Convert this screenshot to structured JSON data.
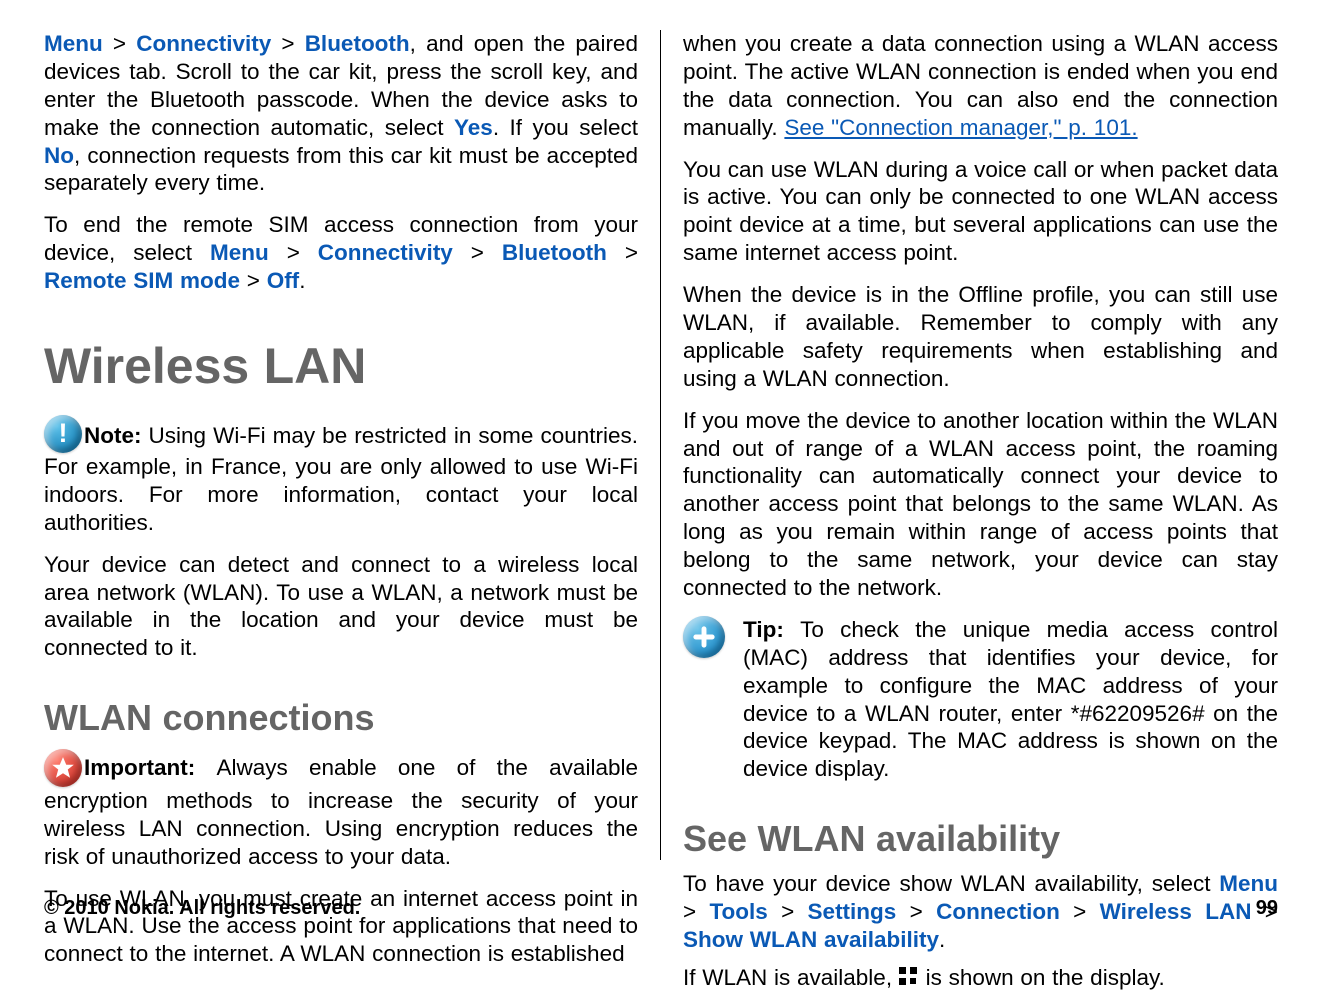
{
  "left": {
    "p1_prefix_menu": "Menu",
    "p1_gt1": " > ",
    "p1_connectivity": "Connectivity",
    "p1_gt2": " > ",
    "p1_bluetooth": "Bluetooth",
    "p1_after_bluetooth": ", and open the paired devices tab. Scroll to the car kit, press the scroll key, and enter the Bluetooth passcode. When the device asks to make the connection automatic, select ",
    "p1_yes": "Yes",
    "p1_after_yes": ". If you select ",
    "p1_no": "No",
    "p1_tail": ", connection requests from this car kit must be accepted separately every time.",
    "p2_lead": "To end the remote SIM access connection from your device, select ",
    "p2_menu": "Menu",
    "p2_gt1": " > ",
    "p2_conn": "Connectivity",
    "p2_gt2": " > ",
    "p2_bt": "Bluetooth",
    "p2_gt3": " > ",
    "p2_remote": "Remote SIM mode",
    "p2_gt4": " > ",
    "p2_off": "Off",
    "p2_period": ".",
    "h1": "Wireless LAN",
    "note_label": "Note:  ",
    "note_body": "Using Wi-Fi may be restricted in some countries. For example, in France, you are only allowed to use Wi-Fi indoors. For more information, contact your local authorities.",
    "p3": "Your device can detect and connect to a wireless local area network (WLAN). To use a WLAN, a network must be available in the location and your device must be connected to it.",
    "h2": "WLAN connections",
    "important_label": "Important:  ",
    "important_body": "Always enable one of the available encryption methods to increase the security of your wireless LAN connection. Using encryption reduces the risk of unauthorized access to your data.",
    "p4": "To use WLAN, you must create an internet access point in a WLAN. Use the access point for applications that need to connect to the internet. A WLAN connection is established"
  },
  "right": {
    "p5_lead": "when you create a data connection using a WLAN access point. The active WLAN connection is ended when you end the data connection. You can also end the connection manually. ",
    "p5_link": "See \"Connection manager,\" p. 101.",
    "p6": "You can use WLAN during a voice call or when packet data is active. You can only be connected to one WLAN access point device at a time, but several applications can use the same internet access point.",
    "p7": "When the device is in the Offline profile, you can still use WLAN, if available. Remember to comply with any applicable safety requirements when establishing and using a WLAN connection.",
    "p8": "If you move the device to another location within the WLAN and out of range of a WLAN access point, the roaming functionality can automatically connect your device to another access point that belongs to the same WLAN. As long as you remain within range of access points that belong to the same network, your device can stay connected to the network.",
    "tip_label": "Tip: ",
    "tip_body": "To check the unique media access control (MAC) address that identifies your device, for example to configure the MAC address of your device to a WLAN router, enter *#62209526# on the device keypad. The MAC address is shown on the device display.",
    "h2b": "See WLAN availability",
    "p9_lead": "To have your device show WLAN availability, select ",
    "p9_menu": "Menu",
    "p9_gt1": " > ",
    "p9_tools": "Tools",
    "p9_gt2": " > ",
    "p9_settings": "Settings",
    "p9_gt3": " > ",
    "p9_connection": "Connection",
    "p9_gt4": " > ",
    "p9_wlan": "Wireless LAN",
    "p9_gt5": " > ",
    "p9_show": "Show WLAN availability",
    "p9_period": ".",
    "p10_lead": "If WLAN is available, ",
    "p10_tail": " is shown on the display."
  },
  "footer": {
    "copyright": "© 2010 Nokia. All rights reserved.",
    "page": "99"
  }
}
